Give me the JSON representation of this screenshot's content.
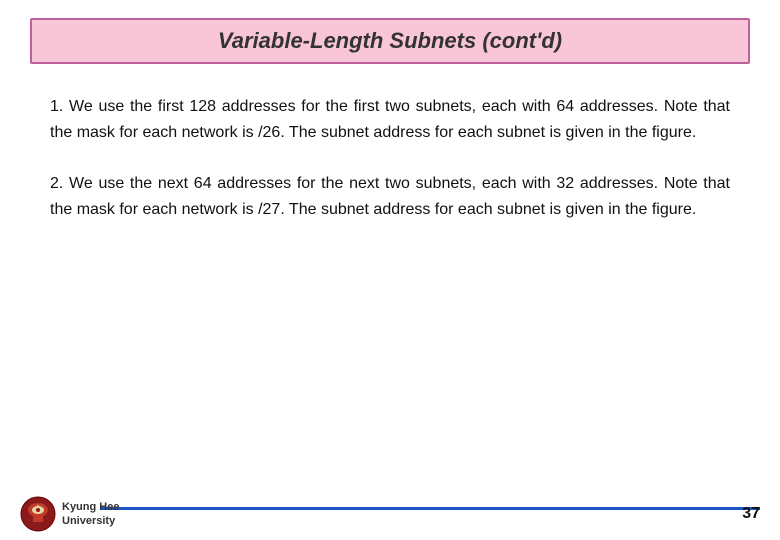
{
  "title": "Variable-Length Subnets (cont'd)",
  "content": {
    "paragraph1": "1.  We use the first 128 addresses for the first two subnets, each with 64 addresses. Note that the mask for each network is /26. The subnet address for each subnet is given in the figure.",
    "paragraph2": "2.  We use the next 64 addresses for the next two subnets, each with 32 addresses. Note that the mask for each network is /27. The subnet address for each subnet is given in the figure."
  },
  "footer": {
    "university_line1": "Kyung Hee",
    "university_line2": "University",
    "page_number": "37"
  },
  "colors": {
    "title_bg": "#f9c6d8",
    "title_border": "#c0609a",
    "footer_line": "#1a56c4"
  }
}
